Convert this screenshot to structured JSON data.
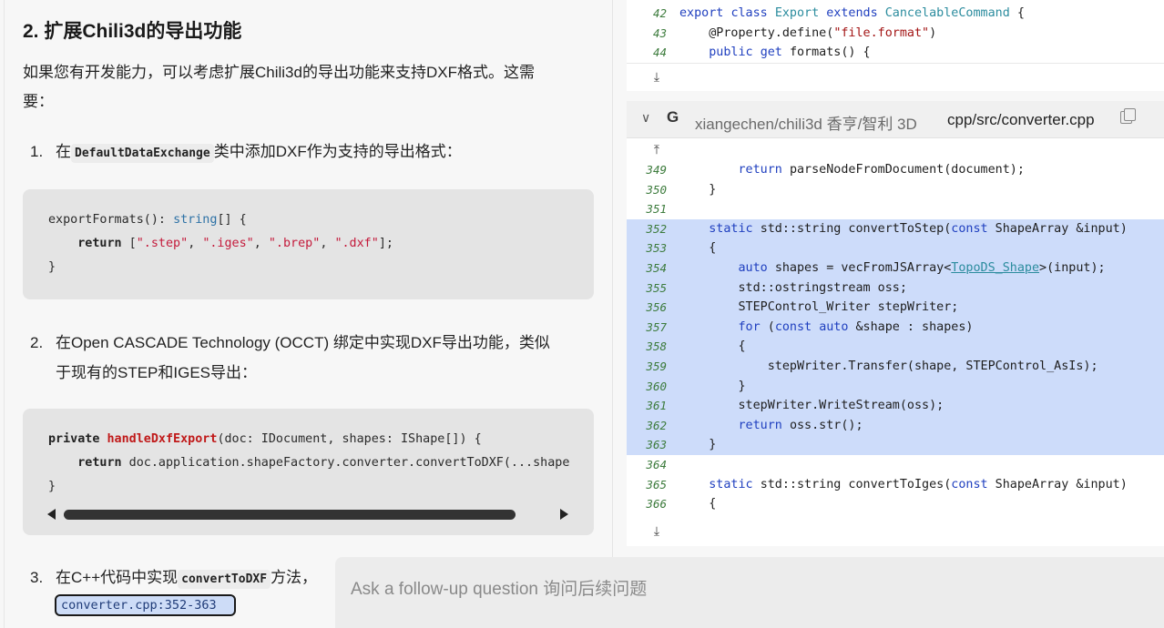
{
  "left": {
    "heading": "2. 扩展Chili3d的导出功能",
    "intro_line1": "如果您有开发能力，可以考虑扩展Chili3d的导出功能来支持DXF格式。这需",
    "intro_line2": "要：",
    "items": [
      {
        "num": "1.",
        "pre": "在",
        "code": "DefaultDataExchange",
        "post": "类中添加DXF作为支持的导出格式："
      },
      {
        "num": "2.",
        "line1": "在Open CASCADE Technology (OCCT) 绑定中实现DXF导出功能，类似",
        "line2": "于现有的STEP和IGES导出："
      },
      {
        "num": "3.",
        "pre": "在C++代码中实现",
        "code": "convertToDXF",
        "post": "方法，"
      }
    ],
    "code1": {
      "l1_a": "exportFormats(): ",
      "l1_type": "string",
      "l1_b": "[] {",
      "l2_kw": "return",
      "l2_a": " [",
      "s1": "\".step\"",
      "s2": "\".iges\"",
      "s3": "\".brep\"",
      "s4": "\".dxf\"",
      "l2_end": "];",
      "l3": "}"
    },
    "code2": {
      "l1_kw": "private",
      "l1_fn": "handleDxfExport",
      "l1_rest": "(doc: IDocument, shapes: IShape[]) {",
      "l2_kw": "return",
      "l2_rest": " doc.application.shapeFactory.converter.convertToDXF(...shape",
      "l3": "}"
    },
    "ref_chip": "converter.cpp:352-363"
  },
  "right": {
    "top_lines": [
      {
        "no": "42",
        "parts": [
          [
            "ck",
            "export "
          ],
          [
            "ck",
            "class "
          ],
          [
            "ctype",
            "Export "
          ],
          [
            "ck",
            "extends "
          ],
          [
            "ctype",
            "CancelableCommand "
          ],
          [
            "",
            "{"
          ]
        ]
      },
      {
        "no": "43",
        "parts": [
          [
            "",
            "    @Property.define("
          ],
          [
            "cs",
            "\"file.format\""
          ],
          [
            "",
            ")"
          ]
        ]
      },
      {
        "no": "44",
        "parts": [
          [
            "",
            "    "
          ],
          [
            "ck",
            "public "
          ],
          [
            "ck",
            "get "
          ],
          [
            "",
            "formats() {"
          ]
        ]
      }
    ],
    "file_header": {
      "repo": "xiangechen/chili3d  香亨/智利 3D",
      "path": "cpp/src/converter.cpp"
    },
    "lines": [
      {
        "no": "349",
        "hl": false,
        "parts": [
          [
            "",
            "        "
          ],
          [
            "ck",
            "return "
          ],
          [
            "",
            "parseNodeFromDocument(document);"
          ]
        ]
      },
      {
        "no": "350",
        "hl": false,
        "parts": [
          [
            "",
            "    }"
          ]
        ]
      },
      {
        "no": "351",
        "hl": false,
        "parts": [
          [
            "",
            ""
          ]
        ]
      },
      {
        "no": "352",
        "hl": true,
        "parts": [
          [
            "",
            "    "
          ],
          [
            "ck",
            "static "
          ],
          [
            "",
            "std::string convertToStep("
          ],
          [
            "ck",
            "const "
          ],
          [
            "",
            "ShapeArray &input)"
          ]
        ]
      },
      {
        "no": "353",
        "hl": true,
        "parts": [
          [
            "",
            "    {"
          ]
        ]
      },
      {
        "no": "354",
        "hl": true,
        "parts": [
          [
            "",
            "        "
          ],
          [
            "ck",
            "auto "
          ],
          [
            "",
            "shapes = vecFromJSArray<"
          ],
          [
            "ct",
            "TopoDS_Shape"
          ],
          [
            "",
            ">(input);"
          ]
        ]
      },
      {
        "no": "355",
        "hl": true,
        "parts": [
          [
            "",
            "        std::ostringstream oss;"
          ]
        ]
      },
      {
        "no": "356",
        "hl": true,
        "parts": [
          [
            "",
            "        STEPControl_Writer stepWriter;"
          ]
        ]
      },
      {
        "no": "357",
        "hl": true,
        "parts": [
          [
            "",
            "        "
          ],
          [
            "ck",
            "for "
          ],
          [
            "",
            "("
          ],
          [
            "ck",
            "const "
          ],
          [
            "ck",
            "auto "
          ],
          [
            "",
            "&shape : shapes)"
          ]
        ]
      },
      {
        "no": "358",
        "hl": true,
        "parts": [
          [
            "",
            "        {"
          ]
        ]
      },
      {
        "no": "359",
        "hl": true,
        "parts": [
          [
            "",
            "            stepWriter.Transfer(shape, STEPControl_AsIs);"
          ]
        ]
      },
      {
        "no": "360",
        "hl": true,
        "parts": [
          [
            "",
            "        }"
          ]
        ]
      },
      {
        "no": "361",
        "hl": true,
        "parts": [
          [
            "",
            "        stepWriter.WriteStream(oss);"
          ]
        ]
      },
      {
        "no": "362",
        "hl": true,
        "parts": [
          [
            "",
            "        "
          ],
          [
            "ck",
            "return "
          ],
          [
            "",
            "oss.str();"
          ]
        ]
      },
      {
        "no": "363",
        "hl": true,
        "parts": [
          [
            "",
            "    }"
          ]
        ]
      },
      {
        "no": "364",
        "hl": false,
        "parts": [
          [
            "",
            ""
          ]
        ]
      },
      {
        "no": "365",
        "hl": false,
        "parts": [
          [
            "",
            "    "
          ],
          [
            "ck",
            "static "
          ],
          [
            "",
            "std::string convertToIges("
          ],
          [
            "ck",
            "const "
          ],
          [
            "",
            "ShapeArray &input)"
          ]
        ]
      },
      {
        "no": "366",
        "hl": false,
        "parts": [
          [
            "",
            "    {"
          ]
        ]
      }
    ]
  },
  "followup": {
    "placeholder": "Ask a follow-up question   询问后续问题"
  }
}
